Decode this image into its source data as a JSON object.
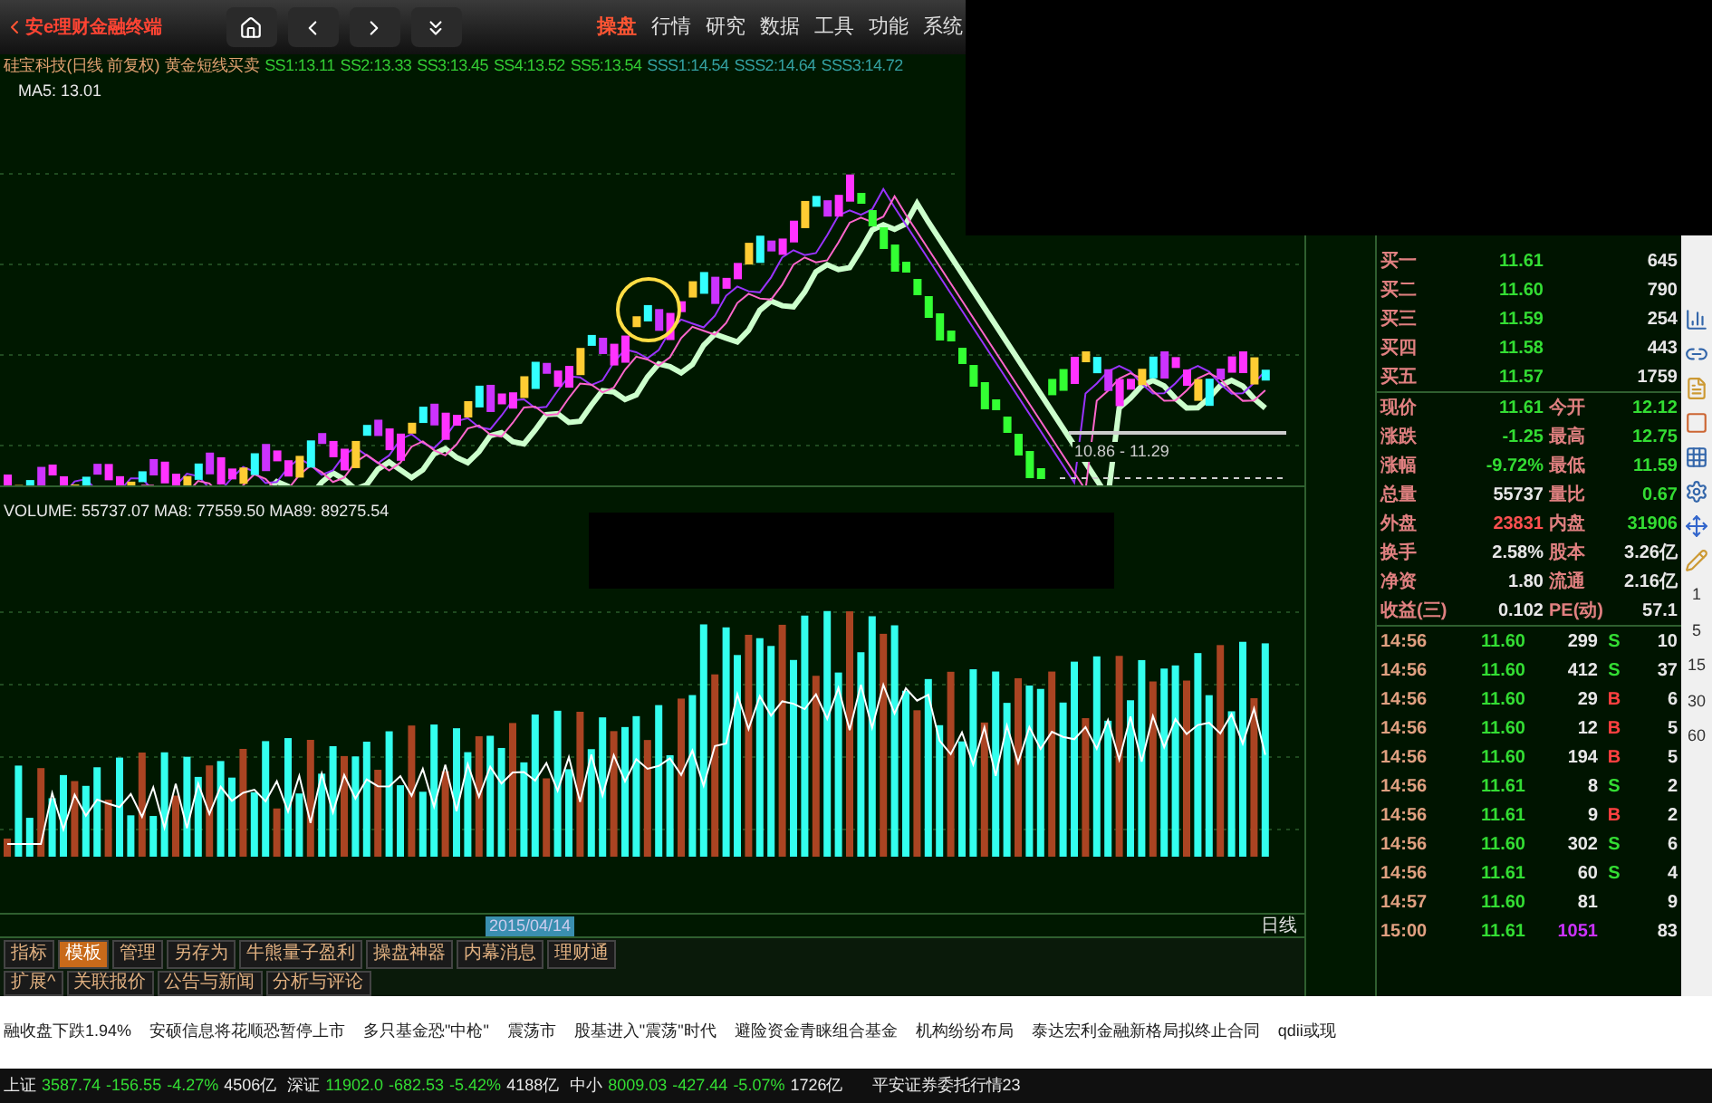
{
  "app_title": "安e理财金融终端",
  "menu": [
    {
      "label": "操盘",
      "selected": true
    },
    {
      "label": "行情",
      "selected": false
    },
    {
      "label": "研究",
      "selected": false
    },
    {
      "label": "数据",
      "selected": false
    },
    {
      "label": "工具",
      "selected": false
    },
    {
      "label": "功能",
      "selected": false
    },
    {
      "label": "系统",
      "selected": false
    }
  ],
  "chart": {
    "title": "硅宝科技(日线 前复权)",
    "indicator": "黄金短线买卖",
    "params": [
      {
        "text": "SS1:13.11",
        "color": "#33cc33"
      },
      {
        "text": "SS2:13.33",
        "color": "#33cc33"
      },
      {
        "text": "SS3:13.45",
        "color": "#33cc33"
      },
      {
        "text": "SS4:13.52",
        "color": "#33cc33"
      },
      {
        "text": "SS5:13.54",
        "color": "#33cc33"
      },
      {
        "text": "SSS1:14.54",
        "color": "#33a0a0"
      },
      {
        "text": "SSS2:14.64",
        "color": "#33a0a0"
      },
      {
        "text": "SSS3:14.72",
        "color": "#33a0a0"
      }
    ],
    "ma5": "MA5: 13.01",
    "range_label": "10.86 - 11.29",
    "volume_header": "VOLUME: 55737.07 MA8: 77559.50 MA89: 89275.54"
  },
  "date_axis": {
    "selected_date": "2015/04/14",
    "period": "日线"
  },
  "tabs": [
    {
      "label": "指标",
      "selected": false
    },
    {
      "label": "模板",
      "selected": true
    },
    {
      "label": "管理",
      "selected": false
    },
    {
      "label": "另存为",
      "selected": false
    },
    {
      "label": "牛熊量子盈利",
      "selected": false
    },
    {
      "label": "操盘神器",
      "selected": false
    },
    {
      "label": "内幕消息",
      "selected": false
    },
    {
      "label": "理财通",
      "selected": false
    }
  ],
  "tabs2": [
    "扩展^",
    "关联报价",
    "公告与新闻",
    "分析与评论"
  ],
  "bids": [
    {
      "label": "买一",
      "price": "11.61",
      "volume": "645"
    },
    {
      "label": "买二",
      "price": "11.60",
      "volume": "790"
    },
    {
      "label": "买三",
      "price": "11.59",
      "volume": "254"
    },
    {
      "label": "买四",
      "price": "11.58",
      "volume": "443"
    },
    {
      "label": "买五",
      "price": "11.57",
      "volume": "1759"
    }
  ],
  "stats": [
    [
      {
        "label": "现价",
        "value": "11.61",
        "color": "#33dd33"
      },
      {
        "label": "今开",
        "value": "12.12",
        "color": "#33dd33"
      }
    ],
    [
      {
        "label": "涨跌",
        "value": "-1.25",
        "color": "#33dd33"
      },
      {
        "label": "最高",
        "value": "12.75",
        "color": "#33dd33"
      }
    ],
    [
      {
        "label": "涨幅",
        "value": "-9.72%",
        "color": "#33dd33"
      },
      {
        "label": "最低",
        "value": "11.59",
        "color": "#33dd33"
      }
    ],
    [
      {
        "label": "总量",
        "value": "55737",
        "color": "#e8e8e8"
      },
      {
        "label": "量比",
        "value": "0.67",
        "color": "#33dd33"
      }
    ],
    [
      {
        "label": "外盘",
        "value": "23831",
        "color": "#ff5050"
      },
      {
        "label": "内盘",
        "value": "31906",
        "color": "#33dd33"
      }
    ],
    [
      {
        "label": "换手",
        "value": "2.58%",
        "color": "#e8e8e8"
      },
      {
        "label": "股本",
        "value": "3.26亿",
        "color": "#e8e8e8"
      }
    ],
    [
      {
        "label": "净资",
        "value": "1.80",
        "color": "#e8e8e8"
      },
      {
        "label": "流通",
        "value": "2.16亿",
        "color": "#e8e8e8"
      }
    ],
    [
      {
        "label": "收益(三)",
        "value": "0.102",
        "color": "#e8e8e8"
      },
      {
        "label": "PE(动)",
        "value": "57.1",
        "color": "#e8e8e8"
      }
    ]
  ],
  "trades": [
    {
      "time": "14:56",
      "price": "11.60",
      "volume": "299",
      "side": "S",
      "count": "10",
      "large": false
    },
    {
      "time": "14:56",
      "price": "11.60",
      "volume": "412",
      "side": "S",
      "count": "37",
      "large": false
    },
    {
      "time": "14:56",
      "price": "11.60",
      "volume": "29",
      "side": "B",
      "count": "6",
      "large": false
    },
    {
      "time": "14:56",
      "price": "11.60",
      "volume": "12",
      "side": "B",
      "count": "5",
      "large": false
    },
    {
      "time": "14:56",
      "price": "11.60",
      "volume": "194",
      "side": "B",
      "count": "5",
      "large": false
    },
    {
      "time": "14:56",
      "price": "11.61",
      "volume": "8",
      "side": "S",
      "count": "2",
      "large": false
    },
    {
      "time": "14:56",
      "price": "11.61",
      "volume": "9",
      "side": "B",
      "count": "2",
      "large": false
    },
    {
      "time": "14:56",
      "price": "11.60",
      "volume": "302",
      "side": "S",
      "count": "6",
      "large": false
    },
    {
      "time": "14:56",
      "price": "11.61",
      "volume": "60",
      "side": "S",
      "count": "4",
      "large": false
    },
    {
      "time": "14:57",
      "price": "11.60",
      "volume": "81",
      "count": "9",
      "large": false
    },
    {
      "time": "15:00",
      "price": "11.61",
      "volume": "1051",
      "count": "83",
      "large": true
    }
  ],
  "periods": [
    "1",
    "5",
    "15",
    "30",
    "60"
  ],
  "news": [
    "融收盘下跌1.94%",
    "安硕信息将花顺恐暂停上市",
    "多只基金恐\"中枪\"",
    "震荡市",
    "股基进入\"震荡\"时代",
    "避险资金青睐组合基金",
    "机构纷纷布局",
    "泰达宏利金融新格局拟终止合同",
    "qdii或现"
  ],
  "indices": [
    {
      "name": "上证",
      "value": "3587.74",
      "change": "-156.55",
      "percent": "-4.27%",
      "amount": "4506亿"
    },
    {
      "name": "深证",
      "value": "11902.0",
      "change": "-682.53",
      "percent": "-5.42%",
      "amount": "4188亿"
    },
    {
      "name": "中小",
      "value": "8009.03",
      "change": "-427.44",
      "percent": "-5.07%",
      "amount": "1726亿"
    }
  ],
  "broker": "平安证券委托行情23"
}
